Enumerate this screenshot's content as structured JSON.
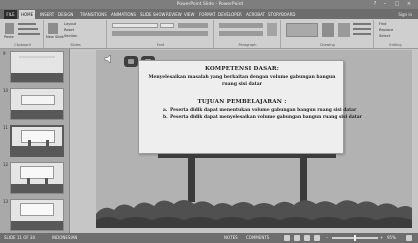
{
  "window": {
    "title": "PowerPoint Slide - PowerPoint"
  },
  "tabs": {
    "file": "FILE",
    "items": [
      "HOME",
      "INSERT",
      "DESIGN",
      "TRANSITIONS",
      "ANIMATIONS",
      "SLIDE SHOW",
      "REVIEW",
      "VIEW",
      "FORMAT",
      "DEVELOPER",
      "ACROBAT",
      "STORYBOARD"
    ],
    "active_index": 0,
    "user": "Sign in"
  },
  "ribbon": {
    "groups": [
      "Clipboard",
      "Slides",
      "Font",
      "Paragraph",
      "Drawing",
      "Editing"
    ],
    "paste": "Paste",
    "new_slide": "New Slide",
    "layout": "Layout",
    "reset": "Reset",
    "section": "Section",
    "find": "Find",
    "replace": "Replace",
    "select": "Select"
  },
  "thumbnails": [
    {
      "num": "9",
      "selected": false
    },
    {
      "num": "10",
      "selected": false
    },
    {
      "num": "11",
      "selected": true
    },
    {
      "num": "12",
      "selected": false
    },
    {
      "num": "13",
      "selected": false
    }
  ],
  "slide": {
    "kd_title": "KOMPETENSI DASAR:",
    "kd_text": "Menyelesaikan masalah yang berkaitan dengan volume gabungan bangun ruang sisi datar",
    "tp_title": "TUJUAN PEMBELAJARAN :",
    "objectives": [
      {
        "marker": "a.",
        "text": "Peserta didik dapat menentukan volume gabungan bangun ruang sisi datar"
      },
      {
        "marker": "b.",
        "text": "Peserta didik dapat menyelesaikan volume gabungan bangun ruang sisi datar"
      }
    ]
  },
  "statusbar": {
    "slide_info": "SLIDE 11 OF 30",
    "language": "INDONESIAN",
    "notes": "NOTES",
    "comments": "COMMENTS",
    "zoom": "95%"
  },
  "colors": {
    "file_tab": "#2d2d2d",
    "board": "#eeeeee",
    "slide_bg": "#b2b2b2",
    "bushes": "#505050"
  },
  "icons": [
    "paste-icon",
    "new-slide-icon",
    "speaker-icon",
    "home-nav-icon",
    "back-nav-icon",
    "normal-view-icon",
    "slide-sorter-icon",
    "reading-view-icon",
    "slideshow-icon",
    "fit-slide-icon"
  ]
}
